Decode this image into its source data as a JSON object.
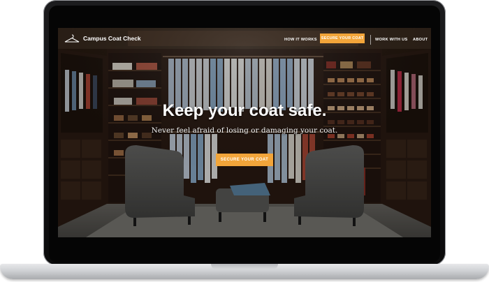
{
  "site": {
    "brand": "Campus Coat Check"
  },
  "nav": {
    "how_it_works": "HOW IT WORKS",
    "secure_your_coat": "SECURE YOUR COAT",
    "work_with_us": "WORK WITH US",
    "about": "ABOUT"
  },
  "hero": {
    "title": "Keep your coat safe.",
    "subtitle": "Never feel afraid of losing or damaging your coat.",
    "cta": "SECURE YOUR COAT"
  },
  "colors": {
    "accent": "#f2a53a",
    "wood": "#3a2417",
    "floor": "#5b5a56"
  }
}
